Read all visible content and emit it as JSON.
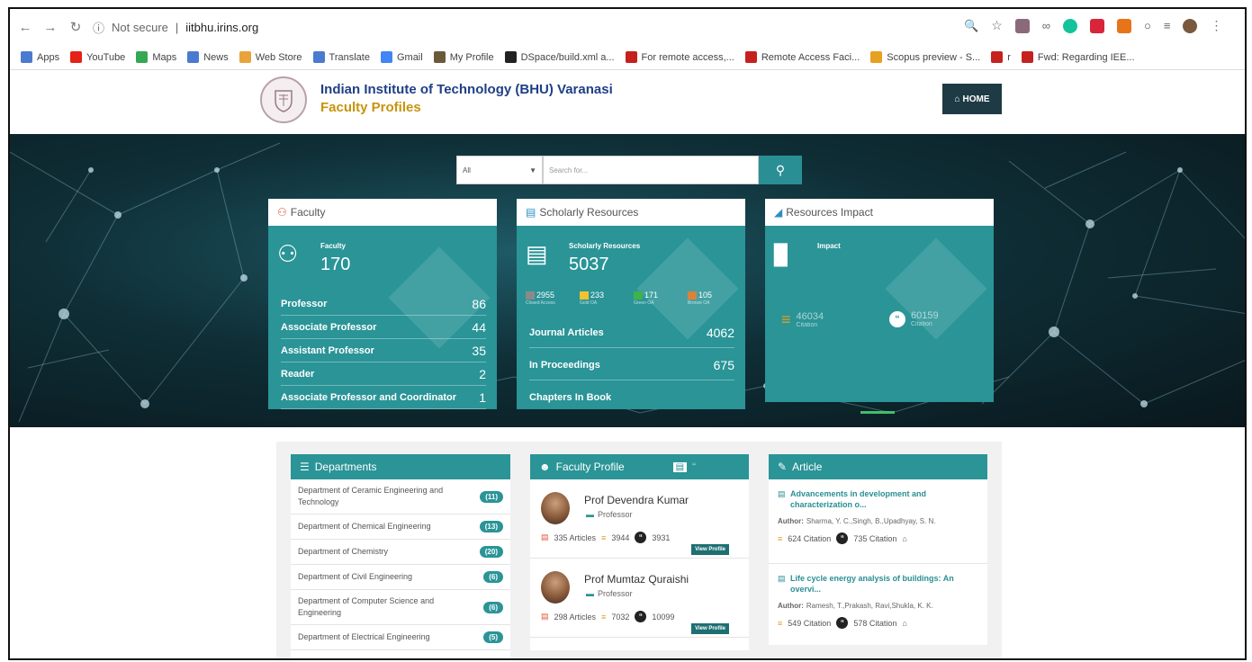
{
  "browser": {
    "security_label": "Not secure",
    "url": "iitbhu.irins.org",
    "bookmarks": [
      {
        "label": "Apps",
        "color": "#4a7bd0"
      },
      {
        "label": "YouTube",
        "color": "#e62117"
      },
      {
        "label": "Maps",
        "color": "#34a853"
      },
      {
        "label": "News",
        "color": "#4a7bd0"
      },
      {
        "label": "Web Store",
        "color": "#e8a33a"
      },
      {
        "label": "Translate",
        "color": "#4a7bd0"
      },
      {
        "label": "Gmail",
        "color": "#4285f4"
      },
      {
        "label": "My Profile",
        "color": "#6b5a3a"
      },
      {
        "label": "DSpace/build.xml a...",
        "color": "#222"
      },
      {
        "label": "For remote access,...",
        "color": "#c5221f"
      },
      {
        "label": "Remote Access Faci...",
        "color": "#c5221f"
      },
      {
        "label": "Scopus preview - S...",
        "color": "#e8a020"
      },
      {
        "label": "r",
        "color": "#c5221f"
      },
      {
        "label": "Fwd: Regarding IEE...",
        "color": "#c5221f"
      }
    ]
  },
  "header": {
    "institute": "Indian Institute of Technology (BHU) Varanasi",
    "subtitle": "Faculty Profiles",
    "home_label": "HOME"
  },
  "search": {
    "scope": "All",
    "placeholder": "Search for..."
  },
  "faculty_card": {
    "header": "Faculty",
    "title": "Faculty",
    "count": "170",
    "rows": [
      {
        "label": "Professor",
        "value": "86"
      },
      {
        "label": "Associate Professor",
        "value": "44"
      },
      {
        "label": "Assistant Professor",
        "value": "35"
      },
      {
        "label": "Reader",
        "value": "2"
      },
      {
        "label": "Associate Professor and Coordinator",
        "value": "1"
      }
    ]
  },
  "scholarly_card": {
    "header": "Scholarly Resources",
    "title": "Scholarly Resources",
    "count": "5037",
    "oa": [
      {
        "value": "2955",
        "label": "Closed Access",
        "color": "#8a8a8a"
      },
      {
        "value": "233",
        "label": "Gold OA",
        "color": "#f2c230"
      },
      {
        "value": "171",
        "label": "Green OA",
        "color": "#3fb24a"
      },
      {
        "value": "105",
        "label": "Bronze OA",
        "color": "#d9823b"
      }
    ],
    "rows": [
      {
        "label": "Journal Articles",
        "value": "4062"
      },
      {
        "label": "In Proceedings",
        "value": "675"
      },
      {
        "label": "Chapters In Book",
        "value": ""
      }
    ]
  },
  "impact_card": {
    "header": "Resources Impact",
    "title": "Impact",
    "scopus_value": "46034",
    "scopus_label": "Citation",
    "google_value": "60159",
    "google_label": "Citation"
  },
  "departments": {
    "header": "Departments",
    "items": [
      {
        "name": "Department of Ceramic Engineering and Technology",
        "count": "(11)"
      },
      {
        "name": "Department of Chemical Engineering",
        "count": "(13)"
      },
      {
        "name": "Department of Chemistry",
        "count": "(20)"
      },
      {
        "name": "Department of Civil Engineering",
        "count": "(6)"
      },
      {
        "name": "Department of Computer Science and Engineering",
        "count": "(6)"
      },
      {
        "name": "Department of Electrical Engineering",
        "count": "(5)"
      }
    ]
  },
  "faculty_profile": {
    "header": "Faculty Profile",
    "people": [
      {
        "name": "Prof Devendra Kumar",
        "designation": "Professor",
        "articles": "335 Articles",
        "scopus": "3944",
        "google": "3931",
        "button": "View Profile"
      },
      {
        "name": "Prof Mumtaz Quraishi",
        "designation": "Professor",
        "articles": "298 Articles",
        "scopus": "7032",
        "google": "10099",
        "button": "View Profile"
      }
    ]
  },
  "articles": {
    "header": "Article",
    "items": [
      {
        "title": "Advancements in development and characterization o...",
        "author_label": "Author:",
        "authors": "Sharma, Y. C.,Singh, B.,Upadhyay, S. N.",
        "scopus": "624 Citation",
        "google": "735 Citation"
      },
      {
        "title": "Life cycle energy analysis of buildings: An overvi...",
        "author_label": "Author:",
        "authors": "Ramesh, T.,Prakash, Ravi,Shukla, K. K.",
        "scopus": "549 Citation",
        "google": "578 Citation"
      }
    ]
  }
}
